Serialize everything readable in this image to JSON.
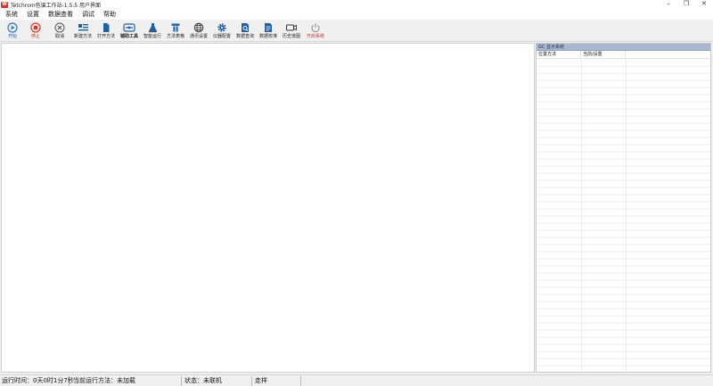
{
  "window": {
    "title": "Tetchrom色谱工作站-1.5.5 用户界面",
    "app_icon_text": "W",
    "controls": {
      "minimize": "–",
      "maximize": "❐",
      "close": "✕"
    }
  },
  "menu": [
    "系统",
    "设置",
    "数据查看",
    "调试",
    "帮助"
  ],
  "toolbar": [
    {
      "label": "开始",
      "icon": "play-icon"
    },
    {
      "label": "停止",
      "icon": "stop-icon"
    },
    {
      "label": "取消",
      "icon": "cancel-icon"
    },
    {
      "label": "新建方法",
      "icon": "new-method-icon"
    },
    {
      "label": "打开方法",
      "icon": "open-method-icon"
    },
    {
      "label": "辅助工具",
      "icon": "tools-icon"
    },
    {
      "label": "智能运行",
      "icon": "smart-run-icon"
    },
    {
      "label": "方法表格",
      "icon": "method-table-icon"
    },
    {
      "label": "通讯设置",
      "icon": "globe-icon"
    },
    {
      "label": "仪器配置",
      "icon": "gear-icon"
    },
    {
      "label": "数据查询",
      "icon": "data-query-icon"
    },
    {
      "label": "数据校准",
      "icon": "data-calibrate-icon"
    },
    {
      "label": "历史谱图",
      "icon": "history-icon"
    },
    {
      "label": "开启系统",
      "icon": "power-icon"
    }
  ],
  "side_panel": {
    "header": "GC 显示系统",
    "columns": [
      "位置方法",
      "当前/设置",
      ""
    ]
  },
  "status": {
    "run_time": "运行时间：0天0时1分7秒",
    "current_method": "当前运行方法：未加载",
    "state": "状态：未联机",
    "select": "走样"
  },
  "colors": {
    "panel_header": "#a9b8d0",
    "stop_red": "#d9352b",
    "play_blue": "#2a78c8",
    "icon_blue": "#1f5fa8"
  }
}
